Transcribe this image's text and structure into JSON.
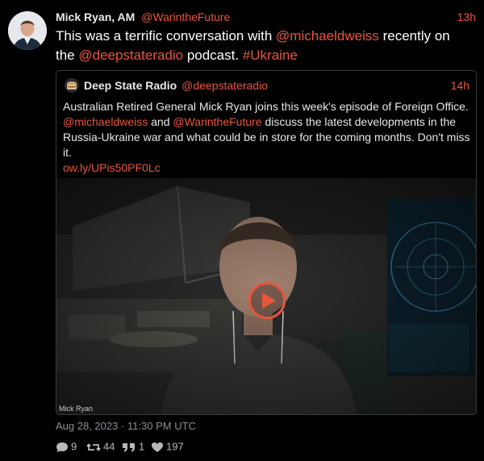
{
  "author": {
    "name": "Mick Ryan, AM",
    "handle": "@WarintheFuture",
    "time": "13h"
  },
  "tweet": {
    "text_before": "This was a terrific conversation with ",
    "mention": "@michaeldweiss",
    "text_middle": " recently on the ",
    "mention2": "@deepstateradio",
    "text_after": " podcast. ",
    "hashtag": "#Ukraine"
  },
  "quote": {
    "name": "Deep State Radio",
    "handle": "@deepstateradio",
    "time": "14h",
    "text_1": "Australian Retired General Mick Ryan joins this week's episode of Foreign Office. ",
    "mention_1": "@michaeldweiss",
    "text_2": " and ",
    "mention_2": "@WarintheFuture",
    "text_3": " discuss the latest developments in the Russia-Ukraine war and what could be in store for the coming months. Don't miss it.",
    "link": "ow.ly/UPis50PF0Lc",
    "video_label": "Mick Ryan"
  },
  "meta": {
    "date": "Aug 28, 2023",
    "separator": " · ",
    "time": "11:30 PM UTC"
  },
  "actions": {
    "replies": "9",
    "retweets": "44",
    "quotes": "1",
    "likes": "197"
  },
  "colors": {
    "accent": "#e8553e",
    "background": "#000000",
    "text": "#e7e9ea",
    "muted": "#8b8f93"
  },
  "icons": [
    "reply-icon",
    "retweet-icon",
    "quote-icon",
    "heart-icon",
    "play-icon"
  ]
}
